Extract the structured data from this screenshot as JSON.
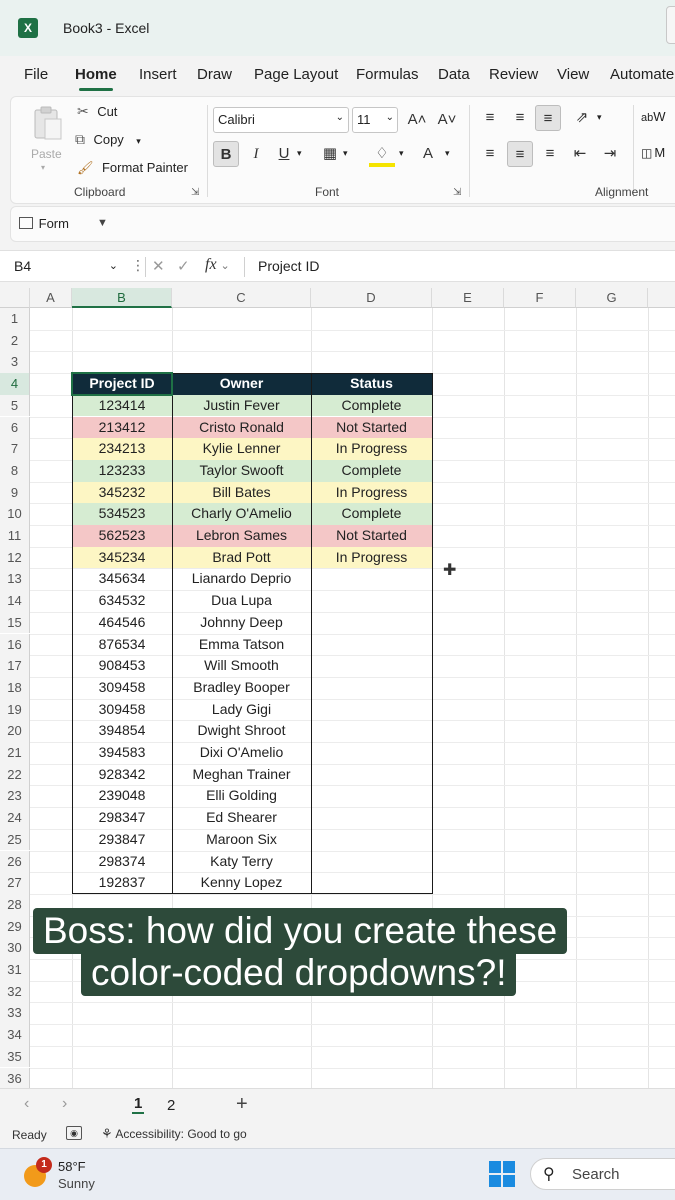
{
  "window": {
    "title": "Book3  -  Excel",
    "app_icon": "excel-icon"
  },
  "ribbon_tabs": [
    "File",
    "Home",
    "Insert",
    "Draw",
    "Page Layout",
    "Formulas",
    "Data",
    "Review",
    "View",
    "Automate"
  ],
  "active_tab": "Home",
  "clipboard": {
    "paste": "Paste",
    "cut": "Cut",
    "copy": "Copy",
    "format_painter": "Format Painter",
    "group": "Clipboard"
  },
  "font": {
    "name": "Calibri",
    "size": "11",
    "bold": "B",
    "italic": "I",
    "underline": "U",
    "grow": "A˄",
    "shrink": "A˅",
    "color": "A",
    "group": "Font"
  },
  "alignment": {
    "group": "Alignment",
    "wrap": "W",
    "merge": "M"
  },
  "form_button": "Form",
  "formula_bar": {
    "name_box": "B4",
    "fx": "fx",
    "content": "Project ID"
  },
  "columns": [
    "A",
    "B",
    "C",
    "D",
    "E",
    "F",
    "G"
  ],
  "rows": [
    "1",
    "2",
    "3",
    "4",
    "5",
    "6",
    "7",
    "8",
    "9",
    "10",
    "11",
    "12",
    "13",
    "14",
    "15",
    "16",
    "17",
    "18",
    "19",
    "20",
    "21",
    "22",
    "23",
    "24",
    "25",
    "26",
    "27",
    "28",
    "29",
    "30",
    "31",
    "32",
    "33",
    "34",
    "35",
    "36"
  ],
  "table": {
    "headers": [
      "Project ID",
      "Owner",
      "Status"
    ],
    "rows": [
      {
        "id": "123414",
        "owner": "Justin Fever",
        "status": "Complete"
      },
      {
        "id": "213412",
        "owner": "Cristo Ronald",
        "status": "Not Started"
      },
      {
        "id": "234213",
        "owner": "Kylie Lenner",
        "status": "In Progress"
      },
      {
        "id": "123233",
        "owner": "Taylor Swooft",
        "status": "Complete"
      },
      {
        "id": "345232",
        "owner": "Bill Bates",
        "status": "In Progress"
      },
      {
        "id": "534523",
        "owner": "Charly O'Amelio",
        "status": "Complete"
      },
      {
        "id": "562523",
        "owner": "Lebron Sames",
        "status": "Not Started"
      },
      {
        "id": "345234",
        "owner": "Brad Pott",
        "status": "In Progress"
      },
      {
        "id": "345634",
        "owner": "Lianardo Deprio",
        "status": ""
      },
      {
        "id": "634532",
        "owner": "Dua Lupa",
        "status": ""
      },
      {
        "id": "464546",
        "owner": "Johnny Deep",
        "status": ""
      },
      {
        "id": "876534",
        "owner": "Emma Tatson",
        "status": ""
      },
      {
        "id": "908453",
        "owner": "Will Smooth",
        "status": ""
      },
      {
        "id": "309458",
        "owner": "Bradley Booper",
        "status": ""
      },
      {
        "id": "309458",
        "owner": "Lady Gigi",
        "status": ""
      },
      {
        "id": "394854",
        "owner": "Dwight Shroot",
        "status": ""
      },
      {
        "id": "394583",
        "owner": "Dixi O'Amelio",
        "status": ""
      },
      {
        "id": "928342",
        "owner": "Meghan Trainer",
        "status": ""
      },
      {
        "id": "239048",
        "owner": "Elli Golding",
        "status": ""
      },
      {
        "id": "298347",
        "owner": "Ed Shearer",
        "status": ""
      },
      {
        "id": "293847",
        "owner": "Maroon Six",
        "status": ""
      },
      {
        "id": "298374",
        "owner": "Katy Terry",
        "status": ""
      },
      {
        "id": "192837",
        "owner": "Kenny Lopez",
        "status": ""
      }
    ]
  },
  "status_colors": {
    "Complete": "#d6ecd2",
    "Not Started": "#f4c7c7",
    "In Progress": "#fdf6c4",
    "header": "#102b3a"
  },
  "caption": {
    "line1": "Boss: how did you create these",
    "line2": "color-coded dropdowns?!"
  },
  "sheet_tabs": [
    "1",
    "2"
  ],
  "active_sheet": "1",
  "status_bar": {
    "ready": "Ready",
    "accessibility": "Accessibility: Good to go"
  },
  "taskbar": {
    "weather_temp": "58°F",
    "weather_desc": "Sunny",
    "badge": "1",
    "search": "Search"
  }
}
